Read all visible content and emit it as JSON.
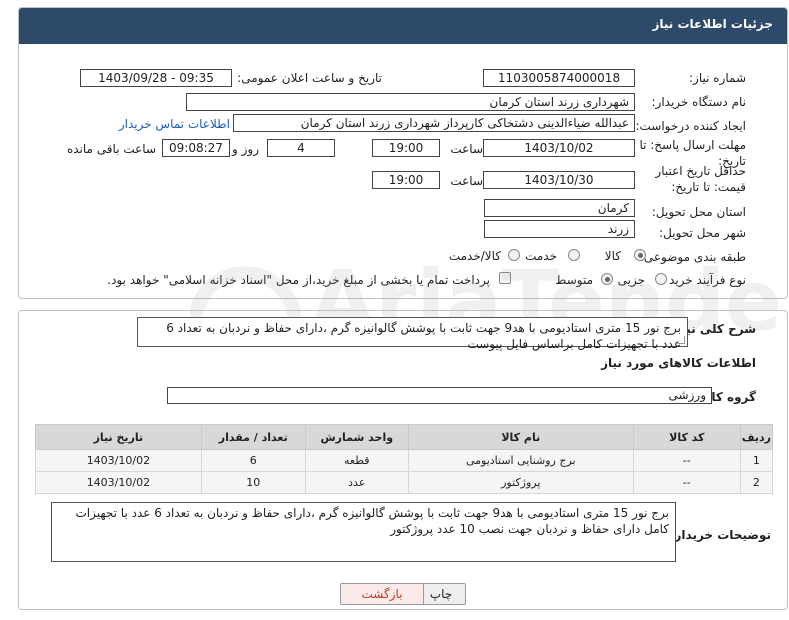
{
  "header": {
    "title": "جزئیات اطلاعات نیاز"
  },
  "fields": {
    "need_number_label": "شماره نیاز:",
    "need_number": "1103005874000018",
    "announce_label": "تاریخ و ساعت اعلان عمومی:",
    "announce_value": "1403/09/28 - 09:35",
    "buyer_org_label": "نام دستگاه خریدار:",
    "buyer_org": "شهرداری زرند استان کرمان",
    "creator_label": "ایجاد کننده درخواست:",
    "creator": "عبدالله ضیاءالدینی دشتخاکی کارپرداز شهرداری زرند استان کرمان",
    "contact_link": "اطلاعات تماس خریدار",
    "deadline_label": "مهلت ارسال پاسخ: تا تاریخ:",
    "deadline_date": "1403/10/02",
    "time_label": "ساعت",
    "deadline_time": "19:00",
    "days_value": "4",
    "days_label": "روز و",
    "remaining_time": "09:08:27",
    "remaining_label": "ساعت باقی مانده",
    "price_validity_label": "حداقل تاریخ اعتبار قیمت: تا تاریخ:",
    "price_validity_date": "1403/10/30",
    "price_validity_time": "19:00",
    "province_label": "استان محل تحویل:",
    "province": "کرمان",
    "city_label": "شهر محل تحویل:",
    "city": "زرند",
    "category_label": "طبقه بندی موضوعی:",
    "category_options": [
      "کالا",
      "خدمت",
      "کالا/خدمت"
    ],
    "process_label": "نوع فرآیند خرید :",
    "process_options": [
      "جزیی",
      "متوسط"
    ],
    "payment_note": "پرداخت تمام یا بخشی از مبلغ خرید،از محل \"اسناد خزانه اسلامی\" خواهد بود."
  },
  "summary": {
    "label": "شرح کلی نیاز:",
    "text": "برج نور 15 متری استادیومی با هد9 جهت ثابت با پوشش گالوانیزه گرم ،دارای حفاظ و نردبان به تعداد 6 عدد با تجهیزات کامل براساس فایل پیوست"
  },
  "goods": {
    "section_title": "اطلاعات کالاهای مورد نیاز",
    "group_label": "گروه کالا:",
    "group_value": "ورزشی",
    "columns": [
      "ردیف",
      "کد کالا",
      "نام کالا",
      "واحد شمارش",
      "تعداد / مقدار",
      "تاریخ نیاز"
    ],
    "rows": [
      [
        "1",
        "--",
        "برج روشنایی استادیومی",
        "قطعه",
        "6",
        "1403/10/02"
      ],
      [
        "2",
        "--",
        "پروژکتور",
        "عدد",
        "10",
        "1403/10/02"
      ]
    ]
  },
  "buyer_notes": {
    "label": "توضیحات خریدار:",
    "text": "برج نور 15 متری استادیومی با هد9 جهت ثابت با پوشش گالوانیزه گرم ،دارای حفاظ و نردبان به تعداد 6 عدد با تجهیزات کامل دارای حفاظ و نردبان جهت نصب 10 عدد پروژکتور"
  },
  "buttons": {
    "print": "چاپ",
    "back": "بازگشت"
  },
  "colors": {
    "header_bg": "#2e4a6b",
    "link": "#1a5fb4",
    "back_button_text": "#c0392b"
  }
}
